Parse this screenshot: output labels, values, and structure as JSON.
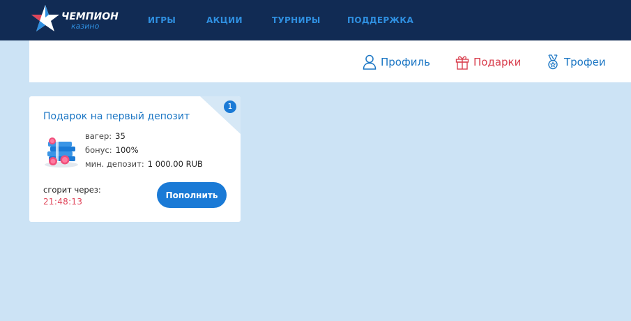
{
  "brand": {
    "name": "ЧЕМПИОН",
    "subtitle": "казино"
  },
  "nav": {
    "items": [
      {
        "label": "ИГРЫ"
      },
      {
        "label": "АКЦИИ"
      },
      {
        "label": "ТУРНИРЫ"
      },
      {
        "label": "ПОДДЕРЖКА"
      }
    ]
  },
  "tabs": {
    "profile": {
      "label": "Профиль",
      "icon": "user-icon"
    },
    "gifts": {
      "label": "Подарки",
      "icon": "gift-icon",
      "active": true
    },
    "trophies": {
      "label": "Трофеи",
      "icon": "medal-icon"
    }
  },
  "gift_card": {
    "badge": "1",
    "title": "Подарок на первый депозит",
    "params": [
      {
        "label": "вагер:",
        "value": "35"
      },
      {
        "label": "бонус:",
        "value": "100%"
      },
      {
        "label": "мин. депозит:",
        "value": "1 000.00 RUB"
      }
    ],
    "expire_label": "сгорит через:",
    "expire_timer": "21:48:13",
    "button_label": "Пополнить",
    "image": "coins-stack-icon"
  },
  "colors": {
    "header_bg": "#112b54",
    "page_bg": "#cce3f5",
    "accent_blue": "#1a7ad6",
    "nav_text": "#2f8fe0",
    "active_red": "#d9404f"
  }
}
